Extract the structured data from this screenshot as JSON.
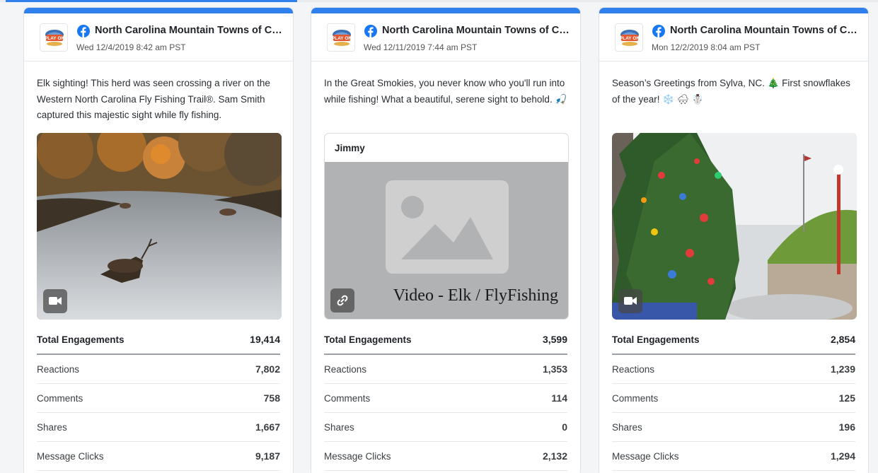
{
  "posts": [
    {
      "page_name": "North Carolina Mountain Towns of Cas...",
      "date": "Wed 12/4/2019 8:42 am PST",
      "text": "Elk sighting! This herd was seen crossing a river on the Western North Carolina Fly Fishing Trail®. Sam Smith captured this majestic sight while fly fishing.",
      "media_type": "video",
      "metrics": {
        "total_label": "Total Engagements",
        "total": "19,414",
        "reactions_label": "Reactions",
        "reactions": "7,802",
        "comments_label": "Comments",
        "comments": "758",
        "shares_label": "Shares",
        "shares": "1,667",
        "clicks_label": "Message Clicks",
        "clicks": "9,187"
      }
    },
    {
      "page_name": "North Carolina Mountain Towns of Cas...",
      "date": "Wed 12/11/2019 7:44 am PST",
      "text": "In the Great Smokies, you never know who you'll run into while fishing! What a beautiful, serene sight to behold. 🎣",
      "media_type": "link",
      "link_title": "Jimmy",
      "link_caption": "Video - Elk / FlyFishing",
      "metrics": {
        "total_label": "Total Engagements",
        "total": "3,599",
        "reactions_label": "Reactions",
        "reactions": "1,353",
        "comments_label": "Comments",
        "comments": "114",
        "shares_label": "Shares",
        "shares": "0",
        "clicks_label": "Message Clicks",
        "clicks": "2,132"
      }
    },
    {
      "page_name": "North Carolina Mountain Towns of Cas...",
      "date": "Mon 12/2/2019 8:04 am PST",
      "text": "Season’s Greetings from Sylva, NC. 🎄 First snowflakes of the year! ❄️ 🌨 ☃️",
      "media_type": "video",
      "metrics": {
        "total_label": "Total Engagements",
        "total": "2,854",
        "reactions_label": "Reactions",
        "reactions": "1,239",
        "comments_label": "Comments",
        "comments": "125",
        "shares_label": "Shares",
        "shares": "196",
        "clicks_label": "Message Clicks",
        "clicks": "1,294"
      }
    }
  ],
  "logo_text": "PLAY ON",
  "colors": {
    "accent": "#2f80ed",
    "facebook": "#1877f2"
  },
  "icons": [
    "facebook-icon",
    "video-camera-icon",
    "link-icon",
    "image-placeholder-icon"
  ]
}
